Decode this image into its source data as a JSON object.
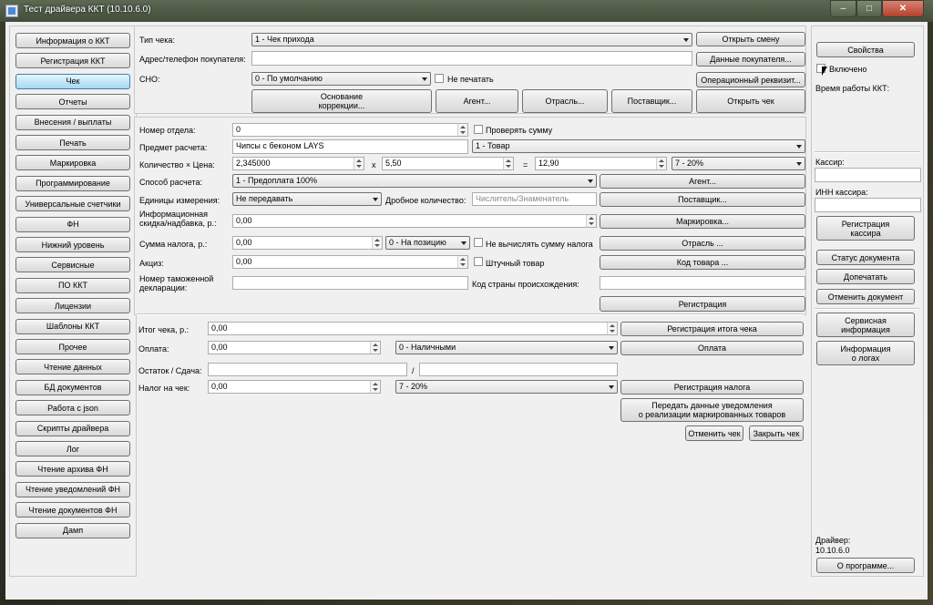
{
  "window": {
    "title": "Тест драйвера ККТ (10.10.6.0)",
    "min_glyph": "–",
    "max_glyph": "□",
    "close_glyph": "✕"
  },
  "sidebar": {
    "items": [
      "Информация о ККТ",
      "Регистрация ККТ",
      "Чек",
      "Отчеты",
      "Внесения / выплаты",
      "Печать",
      "Маркировка",
      "Программирование",
      "Универсальные счетчики",
      "ФН",
      "Нижний уровень",
      "Сервисные",
      "ПО ККТ",
      "Лицензии",
      "Шаблоны ККТ",
      "Прочее",
      "Чтение данных",
      "БД документов",
      "Работа с json",
      "Скрипты драйвера",
      "Лог",
      "Чтение архива ФН",
      "Чтение уведомлений ФН",
      "Чтение документов ФН",
      "Дамп"
    ]
  },
  "receipt": {
    "type_label": "Тип чека:",
    "type_value": "1 - Чек прихода",
    "open_shift": "Открыть смену",
    "buyer_label": "Адрес/телефон покупателя:",
    "buyer_value": "",
    "buyer_data": "Данные покупателя...",
    "sno_label": "СНО:",
    "sno_value": "0 - По умолчанию",
    "no_print": "Не печатать",
    "op_req": "Операционный реквизит...",
    "correction": "Основание\nкоррекции...",
    "agent": "Агент...",
    "industry": "Отрасль...",
    "supplier": "Поставщик...",
    "open_receipt": "Открыть чек"
  },
  "position": {
    "dept_label": "Номер отдела:",
    "dept_value": "0",
    "check_sum": "Проверять сумму",
    "item_label": "Предмет расчета:",
    "item_value": "Чипсы с беконом LAYS",
    "item_type": "1 - Товар",
    "qty_label": "Количество × Цена:",
    "qty_value": "2,345000",
    "times": "x",
    "price_value": "5,50",
    "equals": "=",
    "total_value": "12,90",
    "tax_rate": "7 - 20%",
    "method_label": "Способ расчета:",
    "method_value": "1 - Предоплата 100%",
    "agent": "Агент...",
    "unit_label": "Единицы измерения:",
    "unit_value": "Не передавать",
    "frac_label": "Дробное количество:",
    "frac_placeholder": "Числитель/Знаменатель",
    "supplier": "Поставщик...",
    "discount_label": "Информационная\nскидка/надбавка, р.:",
    "discount_value": "0,00",
    "marking": "Маркировка...",
    "tax_sum_label": "Сумма налога, р.:",
    "tax_sum_value": "0,00",
    "tax_mode": "0 - На позицию",
    "no_calc_tax": "Не вычислять сумму налога",
    "industry": "Отрасль ...",
    "excise_label": "Акциз:",
    "excise_value": "0,00",
    "piece": "Штучный товар",
    "item_code": "Код товара ...",
    "customs_label": "Номер таможенной\nдекларации:",
    "customs_value": "",
    "origin_label": "Код страны происхождения:",
    "origin_value": "",
    "register": "Регистрация"
  },
  "totals": {
    "total_label": "Итог чека, р.:",
    "total_value": "0,00",
    "reg_total": "Регистрация итога чека",
    "pay_label": "Оплата:",
    "pay_value": "0,00",
    "pay_type": "0 - Наличными",
    "pay_btn": "Оплата",
    "change_label": "Остаток / Сдача:",
    "change_value": "",
    "slash": "/",
    "change_value2": "",
    "tax_label": "Налог на чек:",
    "tax_value": "0,00",
    "tax_type": "7 - 20%",
    "reg_tax": "Регистрация налога",
    "notify": "Передать данные уведомления\nо реализации маркированных товаров",
    "cancel": "Отменить чек",
    "close": "Закрыть чек"
  },
  "right": {
    "properties": "Свойства",
    "enabled": "Включено",
    "uptime_label": "Время работы ККТ:",
    "cashier_label": "Кассир:",
    "cashier_value": "",
    "inn_label": "ИНН кассира:",
    "inn_value": "",
    "reg_cashier": "Регистрация\nкассира",
    "doc_status": "Статус документа",
    "reprint": "Допечатать",
    "cancel_doc": "Отменить документ",
    "service_info": "Сервисная\nинформация",
    "log_info": "Информация\nо логах",
    "driver_label": "Драйвер:",
    "driver_version": "10.10.6.0",
    "about": "О программе..."
  }
}
